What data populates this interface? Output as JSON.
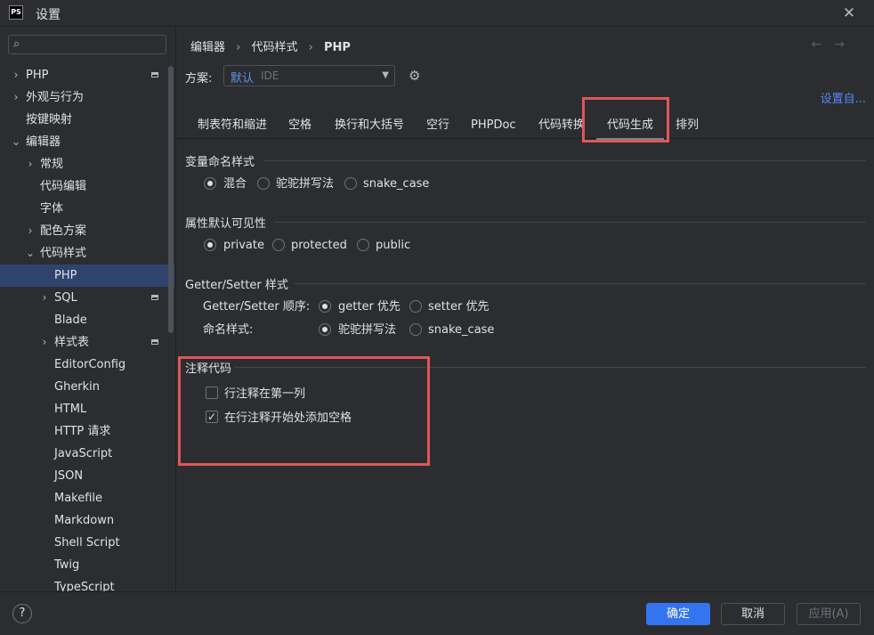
{
  "window": {
    "app_logo_text": "PS",
    "title": "设置",
    "close_icon": "close-icon"
  },
  "sidebar": {
    "search_placeholder": "",
    "items": [
      {
        "label": "PHP",
        "arrow": "›"
      },
      {
        "label": "外观与行为",
        "arrow": "›"
      },
      {
        "label": "按键映射",
        "arrow": ""
      },
      {
        "label": "编辑器",
        "arrow": "⌄"
      },
      {
        "label": "常规",
        "arrow": "›"
      },
      {
        "label": "代码编辑",
        "arrow": ""
      },
      {
        "label": "字体",
        "arrow": ""
      },
      {
        "label": "配色方案",
        "arrow": "›"
      },
      {
        "label": "代码样式",
        "arrow": "⌄"
      },
      {
        "label": "PHP",
        "arrow": ""
      },
      {
        "label": "SQL",
        "arrow": "›"
      },
      {
        "label": "Blade",
        "arrow": ""
      },
      {
        "label": "样式表",
        "arrow": "›"
      },
      {
        "label": "EditorConfig",
        "arrow": ""
      },
      {
        "label": "Gherkin",
        "arrow": ""
      },
      {
        "label": "HTML",
        "arrow": ""
      },
      {
        "label": "HTTP 请求",
        "arrow": ""
      },
      {
        "label": "JavaScript",
        "arrow": ""
      },
      {
        "label": "JSON",
        "arrow": ""
      },
      {
        "label": "Makefile",
        "arrow": ""
      },
      {
        "label": "Markdown",
        "arrow": ""
      },
      {
        "label": "Shell Script",
        "arrow": ""
      },
      {
        "label": "Twig",
        "arrow": ""
      },
      {
        "label": "TypeScript",
        "arrow": ""
      }
    ]
  },
  "breadcrumb": {
    "part1": "编辑器",
    "part2": "代码样式",
    "part3": "PHP",
    "sep": "›"
  },
  "nav": {
    "back": "←",
    "forward": "→"
  },
  "scheme": {
    "label": "方案:",
    "name": "默认",
    "sub": "IDE"
  },
  "set_from_link": "设置自...",
  "tabs": [
    "制表符和缩进",
    "空格",
    "换行和大括号",
    "空行",
    "PHPDoc",
    "代码转换",
    "代码生成",
    "排列"
  ],
  "sections": {
    "var_naming": {
      "title": "变量命名样式",
      "options": [
        "混合",
        "驼驼拼写法",
        "snake_case"
      ]
    },
    "prop_visibility": {
      "title": "属性默认可见性",
      "options": [
        "private",
        "protected",
        "public"
      ]
    },
    "getter_setter": {
      "title": "Getter/Setter 样式",
      "order_label": "Getter/Setter 顺序:",
      "order_options": [
        "getter 优先",
        "setter 优先"
      ],
      "naming_label": "命名样式:",
      "naming_options": [
        "驼驼拼写法",
        "snake_case"
      ]
    },
    "comment_code": {
      "title": "注释代码",
      "line_comment_first_col": "行注释在第一列",
      "add_space": "在行注释开始处添加空格",
      "checked_mark": "✓"
    }
  },
  "footer": {
    "help": "?",
    "ok": "确定",
    "cancel": "取消",
    "apply": "应用(A)"
  },
  "colors": {
    "accent": "#3574f0",
    "highlight": "#e15656",
    "selected_bg": "#2e436e",
    "link": "#548af7"
  }
}
